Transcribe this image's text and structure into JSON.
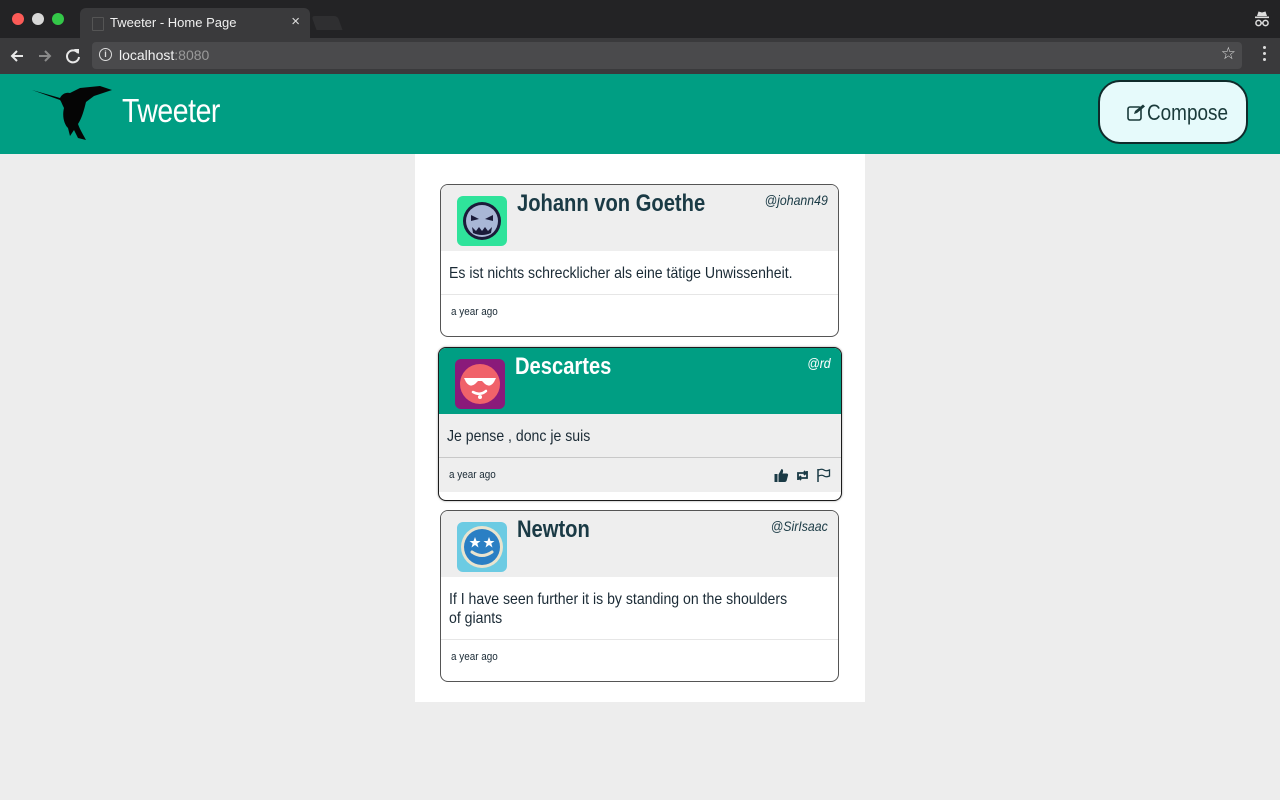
{
  "browser": {
    "tab_title": "Tweeter - Home Page",
    "tab_close": "×",
    "url_host": "localhost",
    "url_port": ":8080"
  },
  "app": {
    "title": "Tweeter",
    "compose_label": "Compose",
    "brand_color": "#009e83"
  },
  "tweets": [
    {
      "name": "Johann von Goethe",
      "handle": "@johann49",
      "text": "Es ist nichts schrecklicher als eine tätige Unwissenheit.",
      "time": "a year ago",
      "avatar_color": "#2fe39b",
      "avatar_icon": "angry-face-icon"
    },
    {
      "name": "Descartes",
      "handle": "@rd",
      "text": "Je pense , donc je suis",
      "time": "a year ago",
      "avatar_color": "#8a1a7a",
      "avatar_icon": "sunglasses-face-icon",
      "hovered": true
    },
    {
      "name": "Newton",
      "handle": "@SirIsaac",
      "text": "If I have seen further it is by standing on the shoulders of giants",
      "time": "a year ago",
      "avatar_color": "#6ccbe3",
      "avatar_icon": "star-eyes-face-icon"
    }
  ]
}
